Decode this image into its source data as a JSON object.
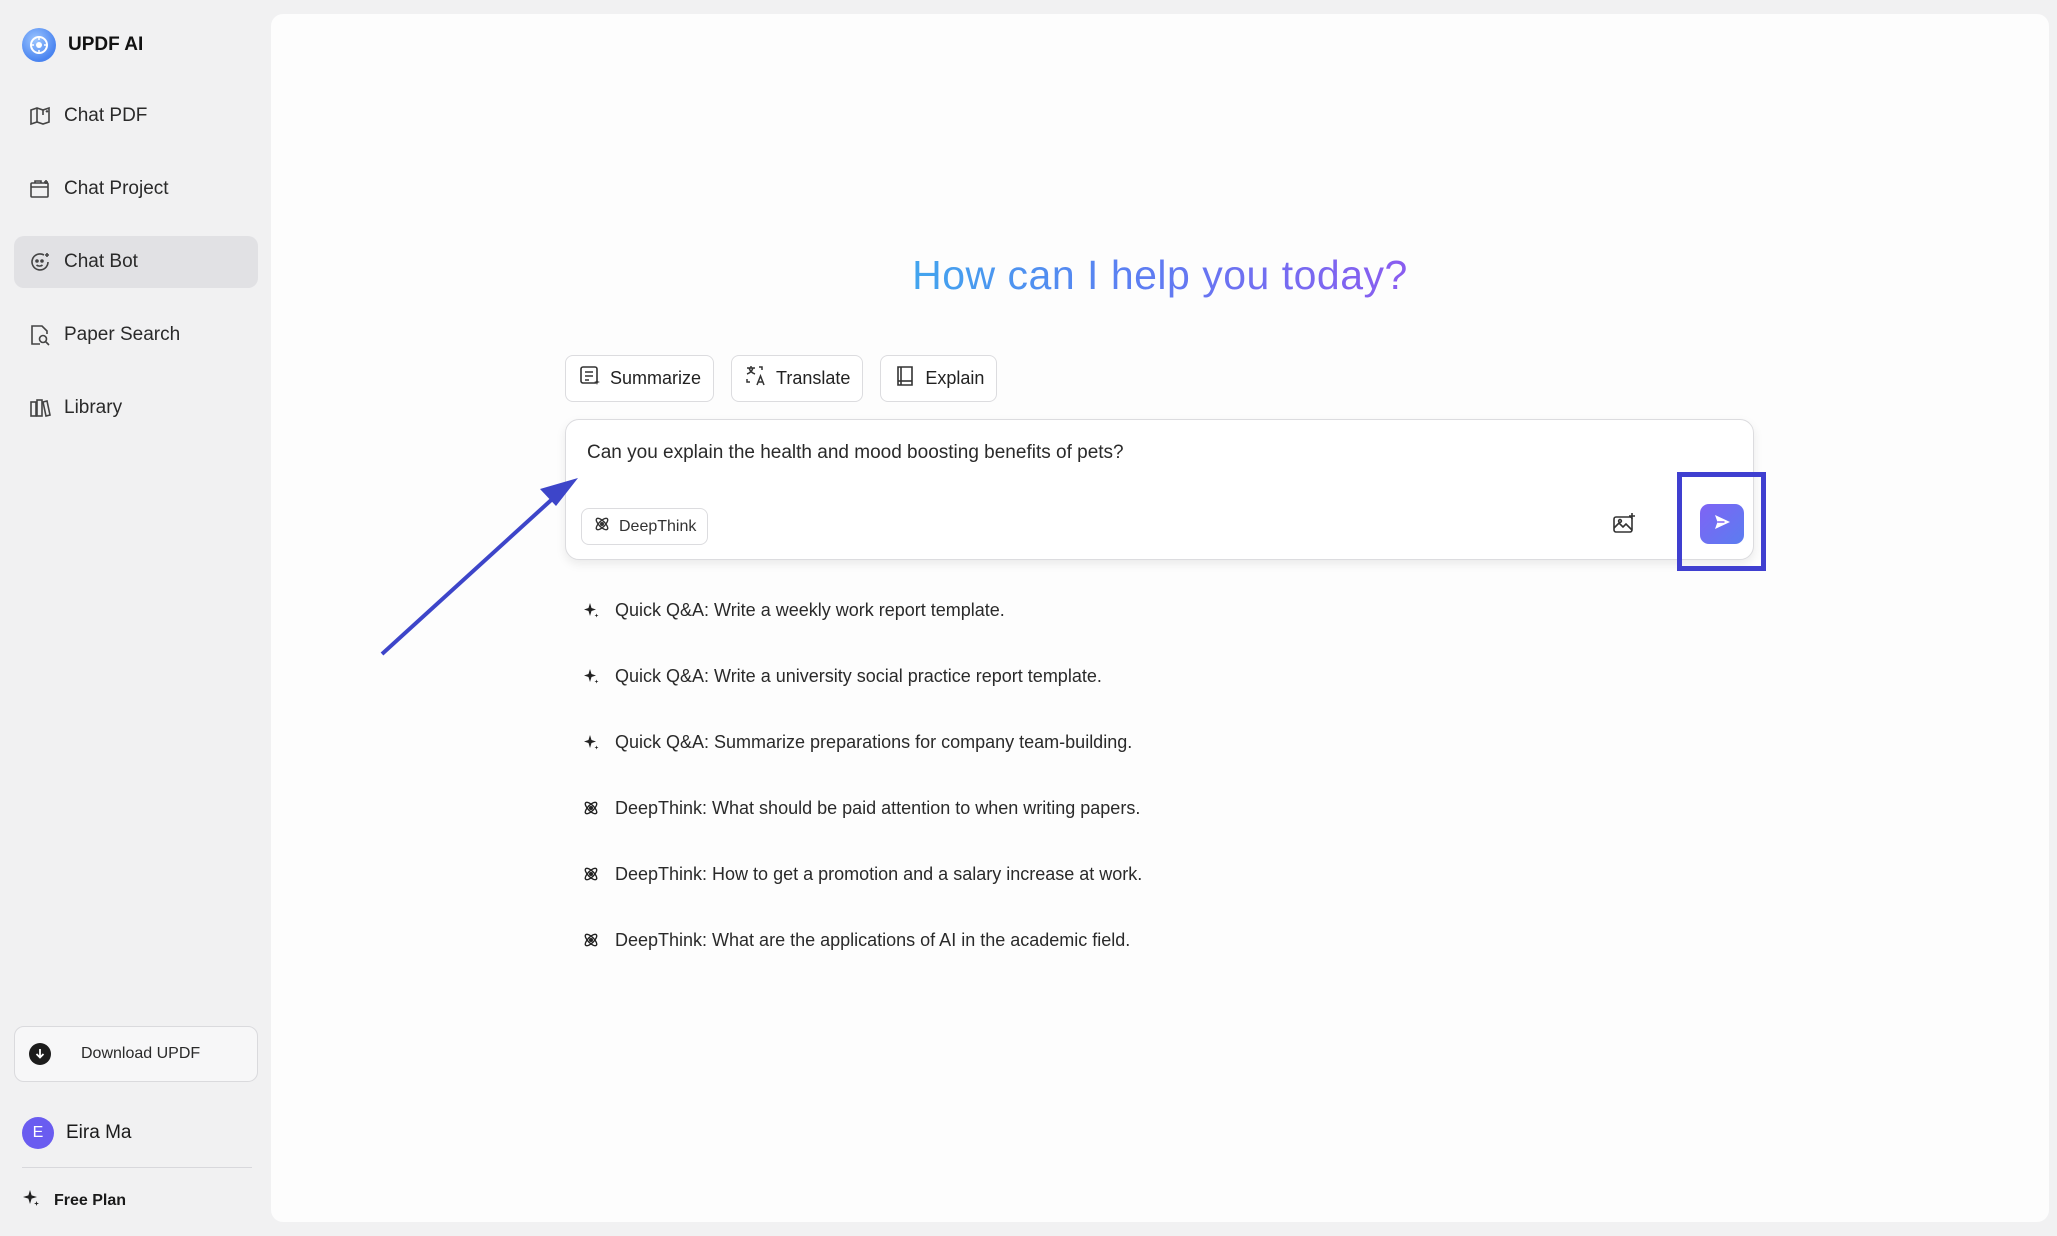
{
  "brand": {
    "name": "UPDF AI"
  },
  "sidebar": {
    "items": [
      {
        "label": "Chat PDF",
        "icon": "chat-pdf-icon"
      },
      {
        "label": "Chat Project",
        "icon": "folder-chat-icon"
      },
      {
        "label": "Chat Bot",
        "icon": "bot-icon",
        "active": true
      },
      {
        "label": "Paper Search",
        "icon": "document-search-icon"
      },
      {
        "label": "Library",
        "icon": "library-icon"
      }
    ],
    "download_label": "Download UPDF",
    "user": {
      "initial": "E",
      "name": "Eira Ma"
    },
    "plan_label": "Free Plan"
  },
  "main": {
    "headline": "How can I help you today?",
    "tools": [
      {
        "label": "Summarize",
        "icon": "summarize-icon"
      },
      {
        "label": "Translate",
        "icon": "translate-icon"
      },
      {
        "label": "Explain",
        "icon": "book-icon"
      }
    ],
    "composer": {
      "text": "Can you explain the health and mood boosting benefits of pets?",
      "deepthink_label": "DeepThink"
    },
    "suggestions": [
      {
        "text": "Quick Q&A: Write a weekly work report template.",
        "icon": "sparkle-icon"
      },
      {
        "text": "Quick Q&A: Write a university social practice report template.",
        "icon": "sparkle-icon"
      },
      {
        "text": "Quick Q&A: Summarize preparations for company team-building.",
        "icon": "sparkle-icon"
      },
      {
        "text": "DeepThink: What should be paid attention to when writing papers.",
        "icon": "atom-icon"
      },
      {
        "text": "DeepThink: How to get a promotion and a salary increase at work.",
        "icon": "atom-icon"
      },
      {
        "text": "DeepThink: What are the applications of AI in the academic field.",
        "icon": "atom-icon"
      }
    ]
  },
  "colors": {
    "accent": "#6b6cf2",
    "highlight_box": "#3f3fd0",
    "arrow": "#3d45c9",
    "headline_gradient": [
      "#42a5ee",
      "#8a5cf0"
    ]
  }
}
